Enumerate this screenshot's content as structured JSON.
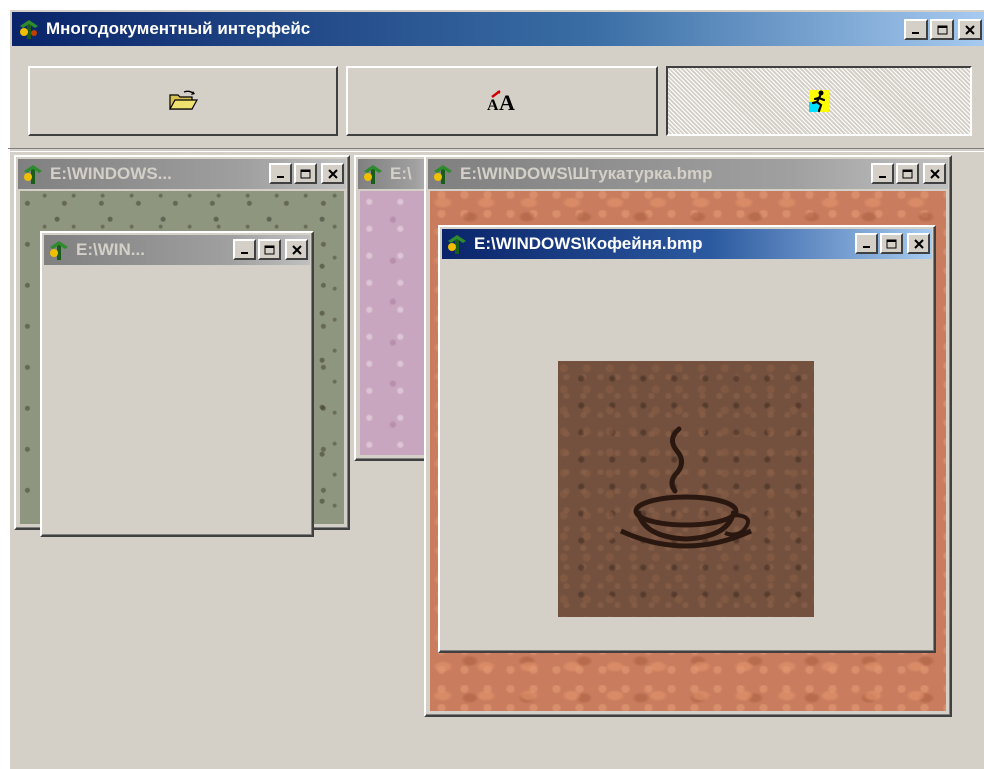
{
  "window": {
    "title": "Многодокументный интерфейс"
  },
  "toolbar": {
    "buttons": [
      {
        "icon": "open-folder-icon",
        "pressed": false
      },
      {
        "icon": "font-icon",
        "pressed": false
      },
      {
        "icon": "running-man-icon",
        "pressed": true
      }
    ]
  },
  "children": [
    {
      "title": "E:\\WINDOWS...",
      "texture": "green-stone",
      "active": false
    },
    {
      "title": "E:\\",
      "texture": "pink-marble",
      "active": false
    },
    {
      "title": "E:\\WINDOWS\\Штукатурка.bmp",
      "texture": "orange-plaster",
      "active": false
    },
    {
      "title": "E:\\WIN...",
      "texture": "coffee",
      "active": false
    },
    {
      "title": "E:\\WINDOWS\\Кофейня.bmp",
      "texture": "coffee",
      "active": true
    }
  ],
  "colors": {
    "face": "#d4d0c8",
    "active_title_start": "#0a246a",
    "active_title_end": "#a6caf0",
    "inactive_title": "#808080"
  }
}
